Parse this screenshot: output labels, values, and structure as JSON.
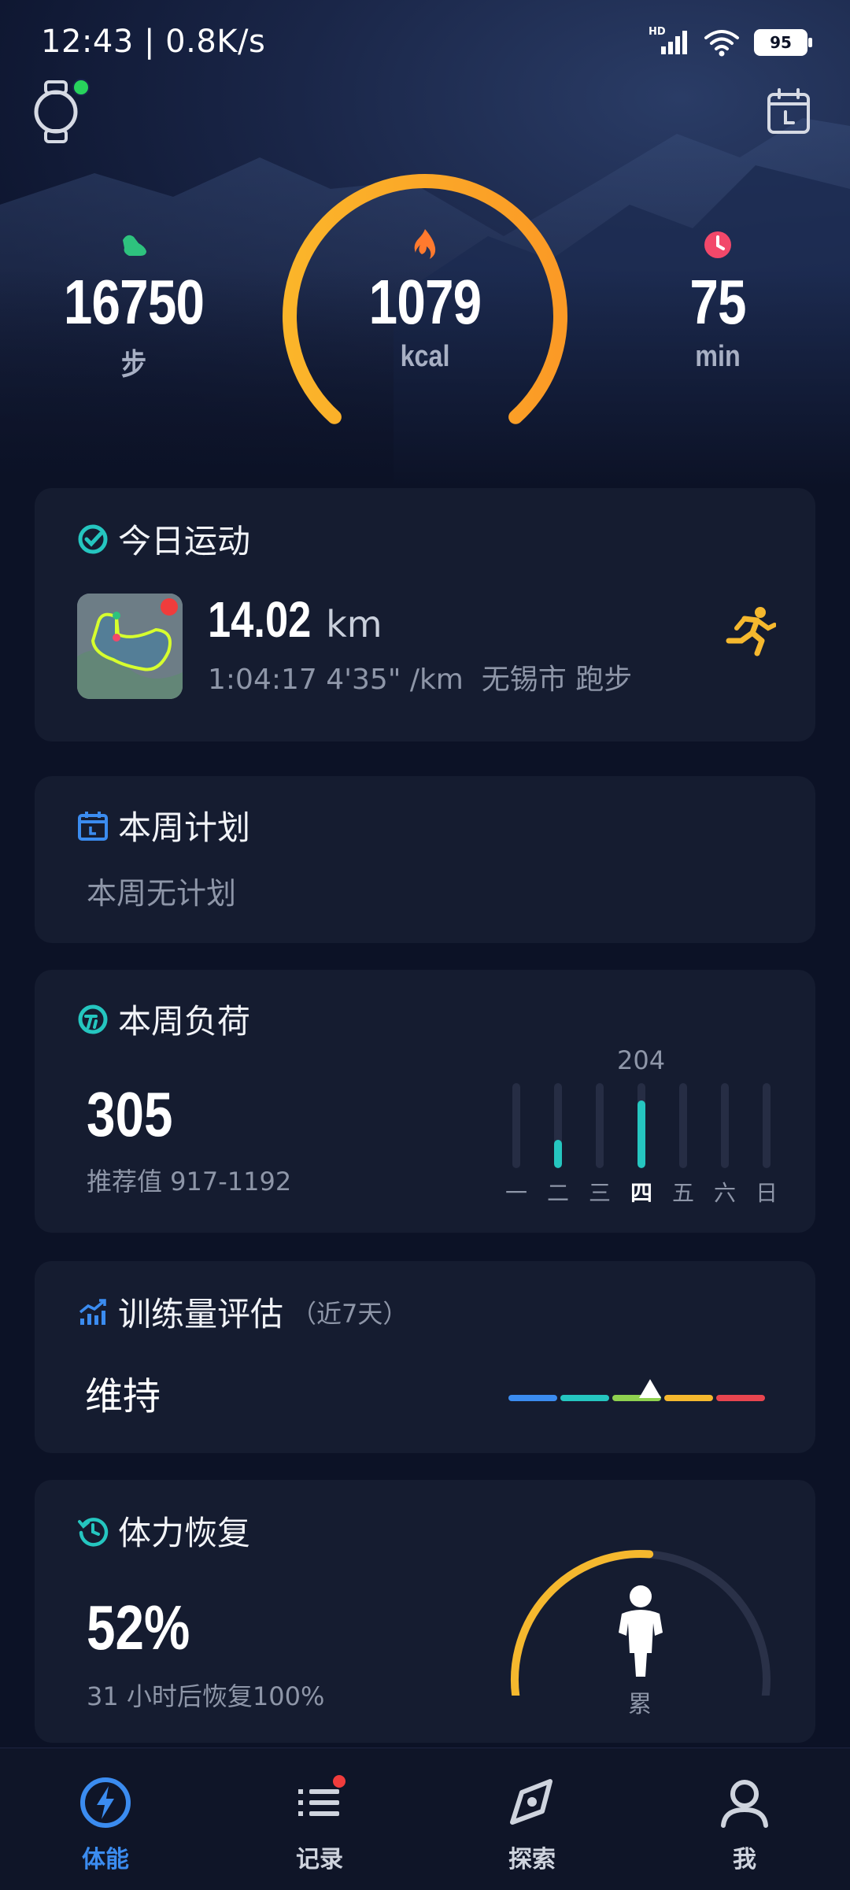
{
  "status": {
    "time": "12:43 | 0.8K/s",
    "battery": "95",
    "network_badge": "HD"
  },
  "header": {
    "watch_icon": "watch-icon",
    "calendar_icon": "calendar-icon"
  },
  "summary": {
    "steps": {
      "value": "16750",
      "unit": "步",
      "icon": "footprint-icon",
      "color": "#2ec27e"
    },
    "calories": {
      "value": "1079",
      "unit": "kcal",
      "icon": "flame-icon",
      "color": "#ff7a2e",
      "ring_progress": 1.0
    },
    "duration": {
      "value": "75",
      "unit": "min",
      "icon": "clock-icon",
      "color": "#f2486a"
    }
  },
  "today_workout": {
    "title": "今日运动",
    "distance": "14.02",
    "distance_unit": "km",
    "details": "1:04:17 4'35\" /km  无锡市 跑步",
    "activity_icon": "running-icon"
  },
  "weekly_plan": {
    "title": "本周计划",
    "empty_text": "本周无计划"
  },
  "weekly_load": {
    "title": "本周负荷",
    "value": "305",
    "recommend": "推荐值 917-1192",
    "peak_label": "204",
    "days": [
      "一",
      "二",
      "三",
      "四",
      "五",
      "六",
      "日"
    ],
    "day_values": [
      0,
      85,
      0,
      204,
      0,
      0,
      0
    ],
    "today_index": 3
  },
  "training_eval": {
    "title": "训练量评估",
    "subtitle": "（近7天）",
    "status": "维持",
    "scale_colors": [
      "#3b8cf0",
      "#25c6c0",
      "#8fd14f",
      "#f5b82e",
      "#e8454f"
    ],
    "marker_position": 0.55
  },
  "recovery": {
    "title": "体力恢复",
    "percent": "52%",
    "detail": "31 小时后恢复100%",
    "state": "累",
    "progress": 0.52
  },
  "nav": [
    {
      "label": "体能",
      "icon": "fitness-bolt-icon",
      "active": true
    },
    {
      "label": "记录",
      "icon": "list-icon",
      "active": false,
      "badge": true
    },
    {
      "label": "探索",
      "icon": "compass-icon",
      "active": false
    },
    {
      "label": "我",
      "icon": "profile-icon",
      "active": false
    }
  ]
}
